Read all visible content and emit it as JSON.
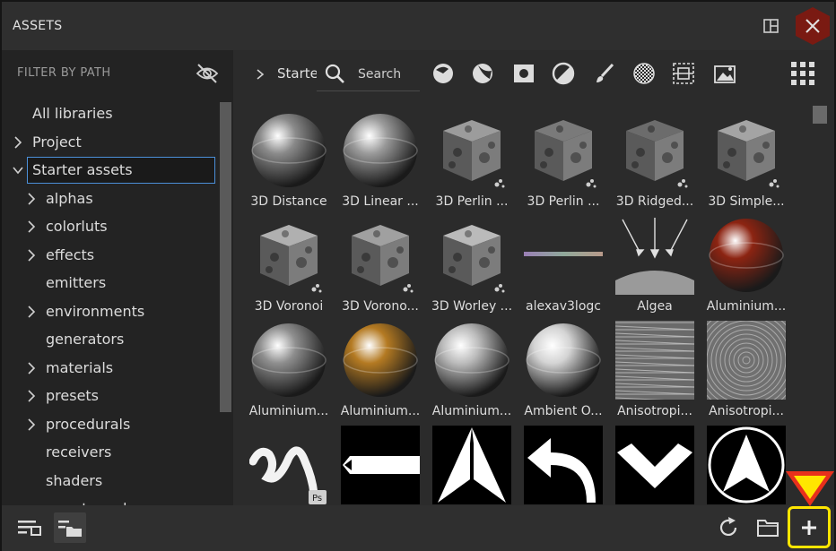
{
  "window": {
    "title": "ASSETS"
  },
  "sidebar": {
    "filter_label": "FILTER BY PATH",
    "items": [
      {
        "label": "All libraries",
        "level": 0,
        "arrow": false
      },
      {
        "label": "Project",
        "level": 0,
        "arrow": true,
        "expanded": false
      },
      {
        "label": "Starter assets",
        "level": 0,
        "arrow": true,
        "expanded": true,
        "selected": true
      },
      {
        "label": "alphas",
        "level": 1,
        "arrow": true
      },
      {
        "label": "colorluts",
        "level": 1,
        "arrow": true
      },
      {
        "label": "effects",
        "level": 1,
        "arrow": true
      },
      {
        "label": "emitters",
        "level": 1,
        "arrow": false
      },
      {
        "label": "environments",
        "level": 1,
        "arrow": true
      },
      {
        "label": "generators",
        "level": 1,
        "arrow": false
      },
      {
        "label": "materials",
        "level": 1,
        "arrow": true
      },
      {
        "label": "presets",
        "level": 1,
        "arrow": true
      },
      {
        "label": "procedurals",
        "level": 1,
        "arrow": true
      },
      {
        "label": "receivers",
        "level": 1,
        "arrow": false
      },
      {
        "label": "shaders",
        "level": 1,
        "arrow": false
      },
      {
        "label": "smart-masks",
        "level": 1,
        "arrow": false
      }
    ]
  },
  "toolbar": {
    "breadcrumb": "Starter assets",
    "search_placeholder": "Search",
    "filter_icons": [
      "smart-material-icon",
      "smart-mask-icon",
      "material-icon",
      "filter-icon",
      "brush-icon",
      "texture-icon",
      "procedural-icon",
      "environment-icon"
    ],
    "view_icon": "grid-view-icon"
  },
  "assets": [
    {
      "label": "3D Distance",
      "kind": "sphere",
      "color": "#8a8a8a"
    },
    {
      "label": "3D Linear ...",
      "kind": "sphere",
      "color": "#9a9a9a"
    },
    {
      "label": "3D Perlin ...",
      "kind": "cube",
      "color": "#9c9c9c"
    },
    {
      "label": "3D Perlin ...",
      "kind": "cube",
      "color": "#7a7a7a"
    },
    {
      "label": "3D Ridged...",
      "kind": "cube",
      "color": "#6c6c6c"
    },
    {
      "label": "3D Simple...",
      "kind": "cube",
      "color": "#a4a4a4"
    },
    {
      "label": "3D Voronoi",
      "kind": "cube",
      "color": "#b0b0b0"
    },
    {
      "label": "3D Vorono...",
      "kind": "cube",
      "color": "#a0a0a0"
    },
    {
      "label": "3D Worley ...",
      "kind": "cube",
      "color": "#bababa"
    },
    {
      "label": "alexav3logc",
      "kind": "strip",
      "color": "#8f8f8f"
    },
    {
      "label": "Algea",
      "kind": "arrows",
      "color": "#d0d0d0"
    },
    {
      "label": "Aluminium...",
      "kind": "sphere",
      "color": "#8c2412"
    },
    {
      "label": "Aluminium...",
      "kind": "sphere",
      "color": "#8e8e8e"
    },
    {
      "label": "Aluminium...",
      "kind": "sphere",
      "color": "#b47a22"
    },
    {
      "label": "Aluminium...",
      "kind": "sphere",
      "color": "#bcbcbc"
    },
    {
      "label": "Ambient O...",
      "kind": "sphere",
      "color": "#d4d4d4"
    },
    {
      "label": "Anisotropi...",
      "kind": "lines",
      "color": "#9a9a9a"
    },
    {
      "label": "Anisotropi...",
      "kind": "swirl",
      "color": "#a6a6a6"
    },
    {
      "label": "",
      "kind": "brush",
      "color": "#ffffff"
    },
    {
      "label": "",
      "kind": "arrow-left",
      "color": "#ffffff"
    },
    {
      "label": "",
      "kind": "arrow-up",
      "color": "#ffffff"
    },
    {
      "label": "",
      "kind": "arrow-curve",
      "color": "#ffffff"
    },
    {
      "label": "",
      "kind": "chevron",
      "color": "#ffffff"
    },
    {
      "label": "",
      "kind": "circle-arrow",
      "color": "#ffffff"
    }
  ],
  "bottombar": {
    "left_icons": [
      "list-view-icon",
      "folder-view-icon"
    ],
    "right_icons": [
      "refresh-icon",
      "folder-icon",
      "plus-icon"
    ]
  },
  "colors": {
    "accent": "#4b8fd8",
    "highlight": "#ffe600",
    "marker": "#e8301c",
    "close_bg": "#7a1a12"
  }
}
